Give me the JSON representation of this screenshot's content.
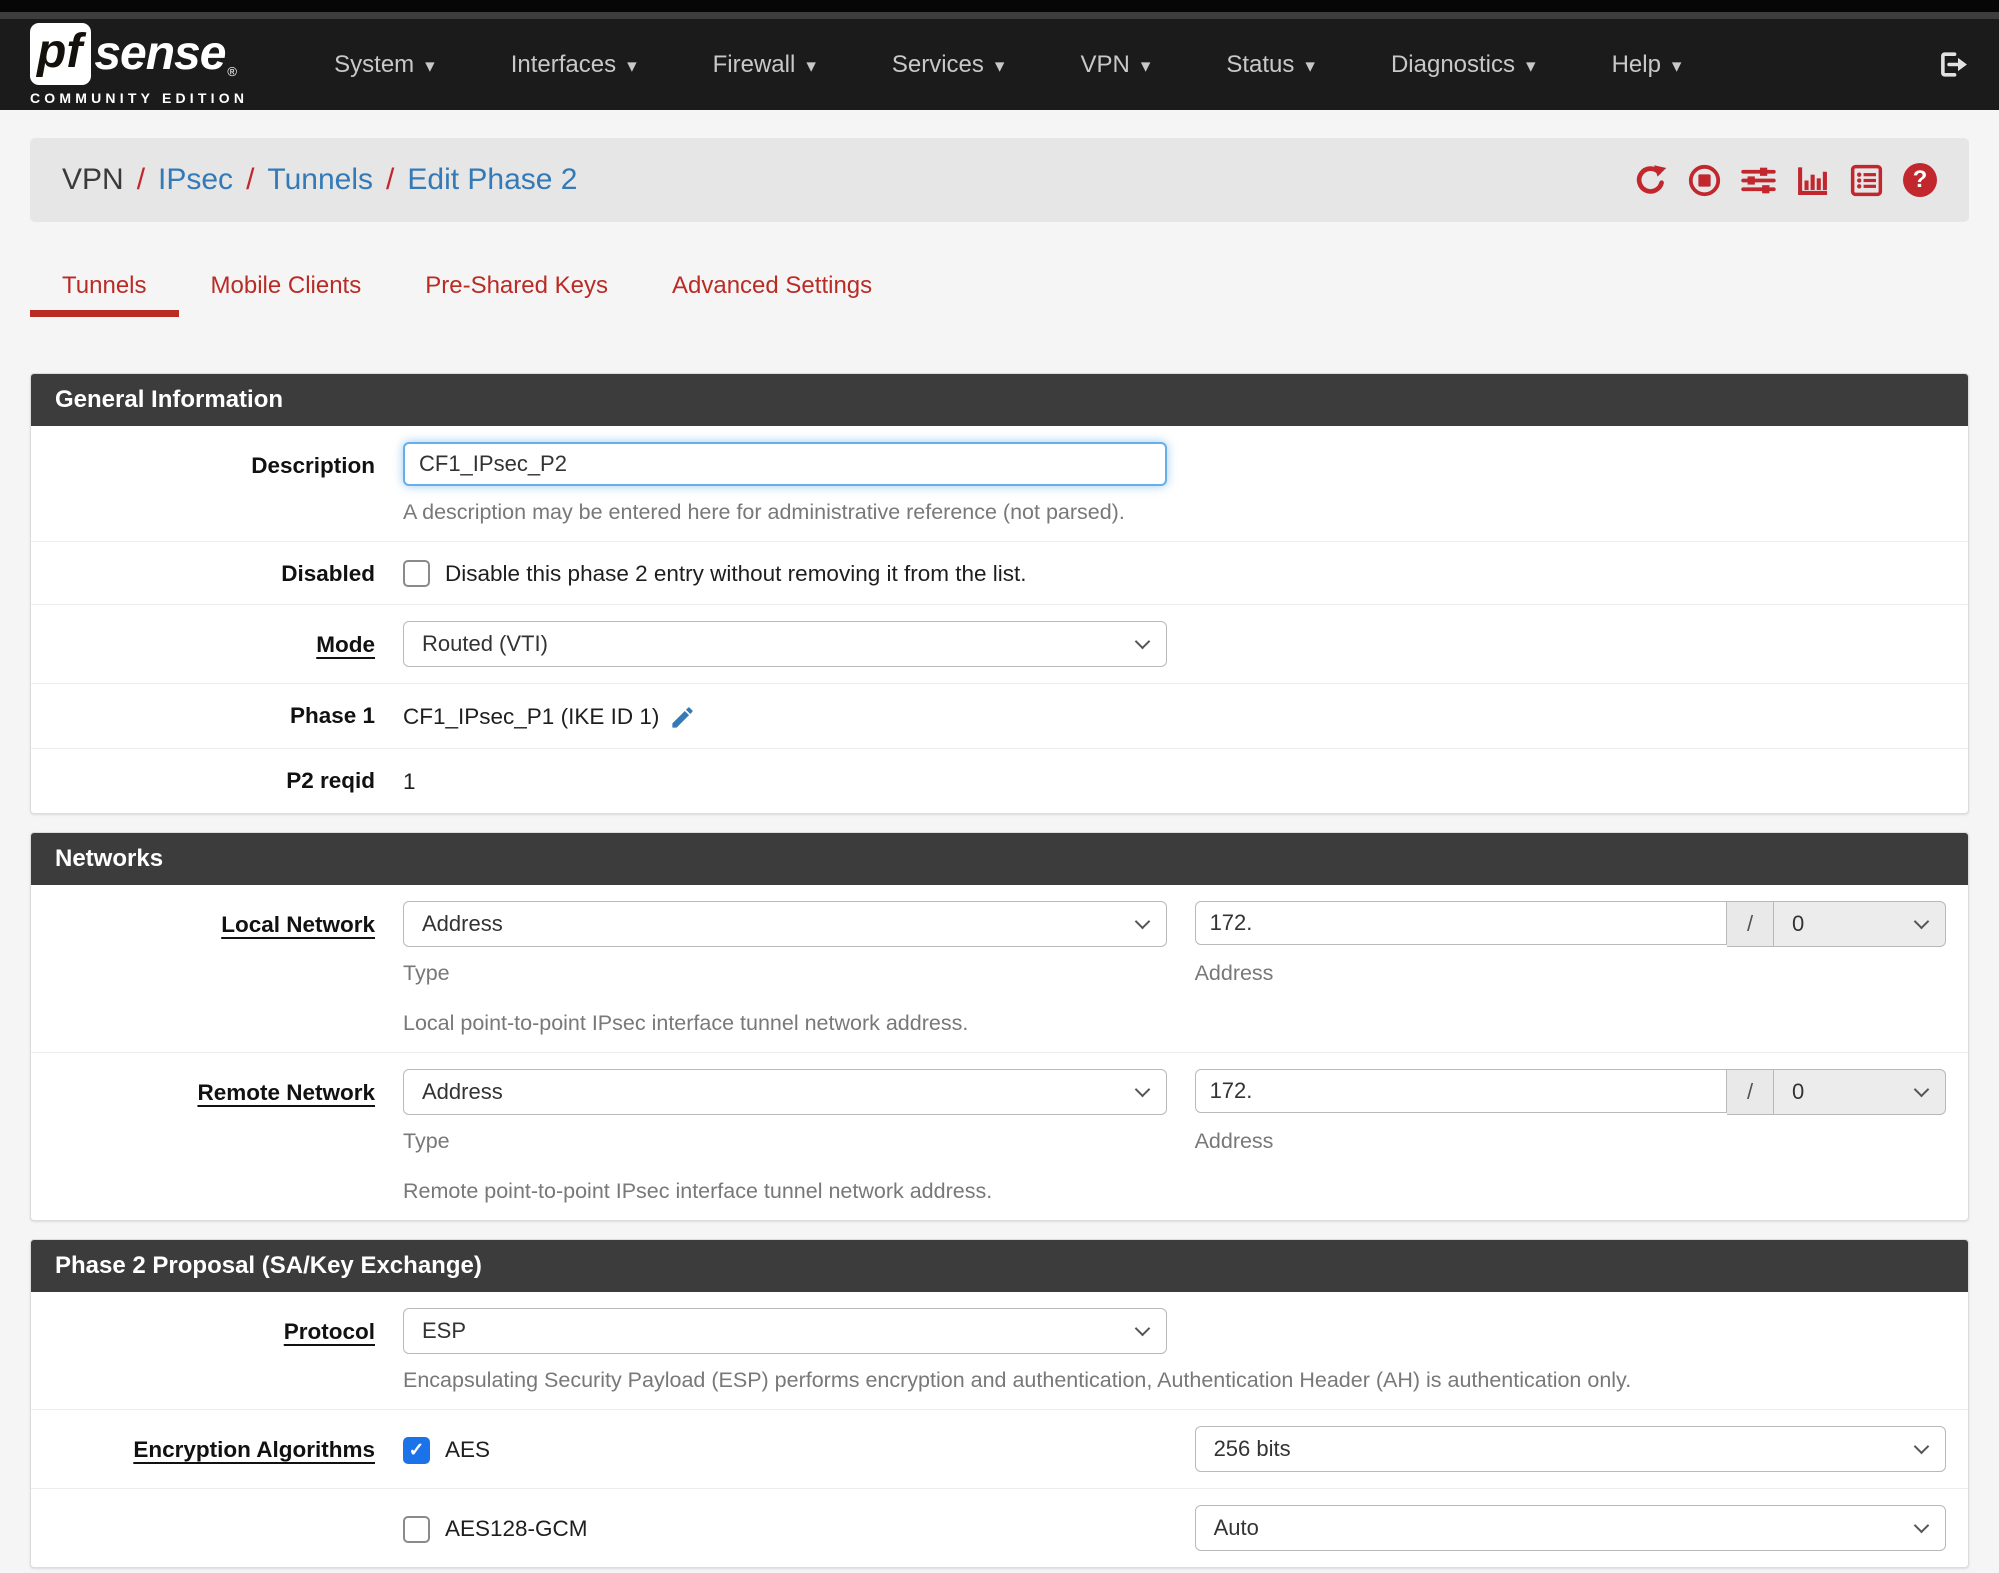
{
  "colors": {
    "accent_red": "#c1272d",
    "link_blue": "#337ab7",
    "panel_header": "#3c3c3c",
    "navbar_bg": "#1b1b1b"
  },
  "navbar": {
    "brand": {
      "pf": "pf",
      "sense": "sense",
      "trademark": "®",
      "edition": "COMMUNITY EDITION"
    },
    "menus": [
      {
        "label": "System"
      },
      {
        "label": "Interfaces"
      },
      {
        "label": "Firewall"
      },
      {
        "label": "Services"
      },
      {
        "label": "VPN"
      },
      {
        "label": "Status"
      },
      {
        "label": "Diagnostics"
      },
      {
        "label": "Help"
      }
    ],
    "logout_icon": "sign-out-icon"
  },
  "breadcrumb": {
    "sep": "/",
    "items": [
      {
        "label": "VPN"
      },
      {
        "label": "IPsec"
      },
      {
        "label": "Tunnels"
      },
      {
        "label": "Edit Phase 2"
      }
    ],
    "action_icons": [
      "refresh-icon",
      "stop-icon",
      "sliders-icon",
      "bar-chart-icon",
      "list-icon",
      "help-icon"
    ]
  },
  "tabs": [
    {
      "label": "Tunnels",
      "active": true
    },
    {
      "label": "Mobile Clients",
      "active": false
    },
    {
      "label": "Pre-Shared Keys",
      "active": false
    },
    {
      "label": "Advanced Settings",
      "active": false
    }
  ],
  "general": {
    "title": "General Information",
    "description": {
      "label": "Description",
      "value": "CF1_IPsec_P2",
      "help": "A description may be entered here for administrative reference (not parsed)."
    },
    "disabled": {
      "label": "Disabled",
      "checked": false,
      "checkbox_label": "Disable this phase 2 entry without removing it from the list."
    },
    "mode": {
      "label": "Mode",
      "value": "Routed (VTI)"
    },
    "phase1": {
      "label": "Phase 1",
      "value": "CF1_IPsec_P1 (IKE ID 1)"
    },
    "p2reqid": {
      "label": "P2 reqid",
      "value": "1"
    }
  },
  "networks": {
    "title": "Networks",
    "local": {
      "label": "Local Network",
      "type_value": "Address",
      "type_help": "Type",
      "address_value": "172.",
      "address_help": "Address",
      "mask_sep": "/",
      "mask_value": "0",
      "help": "Local point-to-point IPsec interface tunnel network address."
    },
    "remote": {
      "label": "Remote Network",
      "type_value": "Address",
      "type_help": "Type",
      "address_value": "172.",
      "address_help": "Address",
      "mask_sep": "/",
      "mask_value": "0",
      "help": "Remote point-to-point IPsec interface tunnel network address."
    }
  },
  "proposal": {
    "title": "Phase 2 Proposal (SA/Key Exchange)",
    "protocol": {
      "label": "Protocol",
      "value": "ESP",
      "help": "Encapsulating Security Payload (ESP) performs encryption and authentication, Authentication Header (AH) is authentication only."
    },
    "encryption": {
      "label": "Encryption Algorithms",
      "rows": [
        {
          "name": "AES",
          "checked": true,
          "bits": "256 bits"
        },
        {
          "name": "AES128-GCM",
          "checked": false,
          "bits": "Auto"
        }
      ]
    }
  }
}
